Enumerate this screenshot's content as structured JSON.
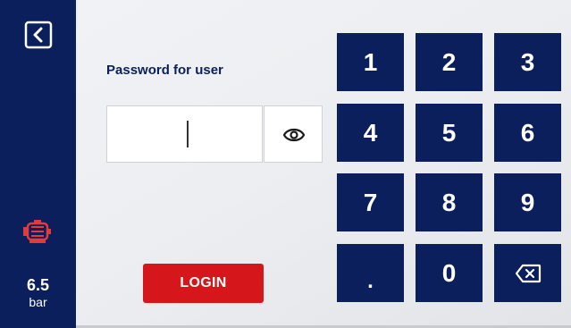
{
  "sidebar": {
    "back_icon": "chevron-left-icon",
    "motor_icon": "motor-icon",
    "pressure": {
      "value": "6.5",
      "unit": "bar"
    },
    "colors": {
      "background": "#0b1f5c",
      "motor": "#e23b3b"
    }
  },
  "login_form": {
    "label": "Password for user",
    "password_value": "",
    "toggle_icon": "eye-icon",
    "login_label": "LOGIN"
  },
  "keypad": {
    "keys": [
      "1",
      "2",
      "3",
      "4",
      "5",
      "6",
      "7",
      "8",
      "9",
      ".",
      "0"
    ],
    "backspace_icon": "backspace-icon"
  },
  "colors": {
    "accent": "#0b1f5c",
    "login": "#d5161b",
    "panel": "#eceef1"
  }
}
